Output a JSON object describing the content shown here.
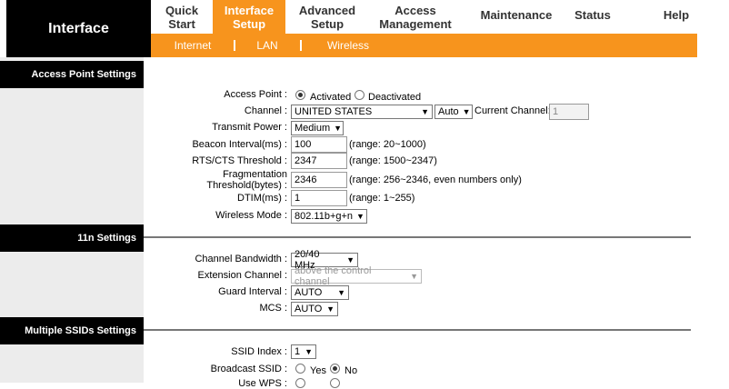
{
  "brand": "Interface",
  "nav": [
    {
      "label": "Quick Start",
      "active": false
    },
    {
      "label": "Interface Setup",
      "active": true
    },
    {
      "label": "Advanced Setup",
      "active": false
    },
    {
      "label": "Access Management",
      "active": false
    },
    {
      "label": "Maintenance",
      "active": false
    },
    {
      "label": "Status",
      "active": false
    },
    {
      "label": "Help",
      "active": false
    }
  ],
  "subnav": [
    "Internet",
    "LAN",
    "Wireless"
  ],
  "sections": {
    "ap": "Access Point Settings",
    "n11": "11n Settings",
    "ssid": "Multiple SSIDs Settings"
  },
  "ap": {
    "access_point_label": "Access Point :",
    "activated": "Activated",
    "deactivated": "Deactivated",
    "channel_label": "Channel :",
    "channel_country": "UNITED STATES",
    "channel_mode": "Auto",
    "current_channel_label": "Current Channel:",
    "current_channel": "1",
    "tx_power_label": "Transmit Power :",
    "tx_power": "Medium",
    "beacon_label": "Beacon Interval(ms) :",
    "beacon": "100",
    "beacon_hint": "(range: 20~1000)",
    "rts_label": "RTS/CTS Threshold :",
    "rts": "2347",
    "rts_hint": "(range: 1500~2347)",
    "frag_label_1": "Fragmentation",
    "frag_label_2": "Threshold(bytes) :",
    "frag": "2346",
    "frag_hint": "(range: 256~2346, even numbers only)",
    "dtim_label": "DTIM(ms) :",
    "dtim": "1",
    "dtim_hint": "(range: 1~255)",
    "mode_label": "Wireless Mode :",
    "mode": "802.11b+g+n"
  },
  "n11": {
    "bw_label": "Channel Bandwidth :",
    "bw": "20/40 MHz",
    "ext_label": "Extension Channel :",
    "ext": "above the control channel",
    "guard_label": "Guard Interval :",
    "guard": "AUTO",
    "mcs_label": "MCS :",
    "mcs": "AUTO"
  },
  "ssid": {
    "index_label": "SSID Index :",
    "index": "1",
    "broadcast_label": "Broadcast SSID :",
    "yes": "Yes",
    "no": "No",
    "wps_label": "Use WPS :"
  }
}
